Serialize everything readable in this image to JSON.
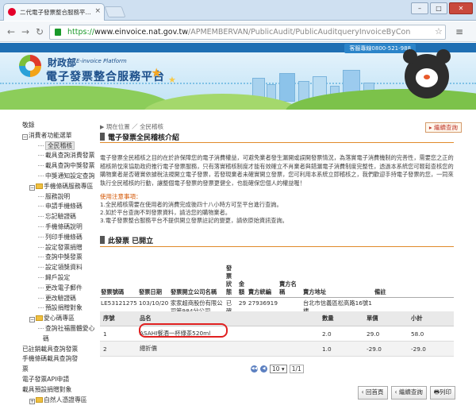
{
  "browser": {
    "tab_title": "二代電子發票整合服務平...",
    "url_scheme": "https://",
    "url_host": "www.einvoice.nat.gov.tw",
    "url_path": "/APMEMBERVAN/PublicAudit/PublicAuditqueryInvoiceByCon"
  },
  "header": {
    "hotline": "客服專線0800-521-988",
    "ministry": "財政部",
    "ministry_en": "E-invoice Platform",
    "platform": "電子發票整合服務平台"
  },
  "sidebar": {
    "items": [
      {
        "label": "敬錄",
        "level": 0
      },
      {
        "label": "消費者功能選單",
        "level": 0,
        "toggle": "-"
      },
      {
        "label": "全民稽核",
        "level": 2,
        "selected": true
      },
      {
        "label": "載具查詢消費發票",
        "level": 2
      },
      {
        "label": "載具查詢中獎發票",
        "level": 2
      },
      {
        "label": "中獎通知設定查詢",
        "level": 2
      },
      {
        "label": "手機條碼服務專區",
        "level": 1,
        "toggle": "-",
        "folder": true
      },
      {
        "label": "服務說明",
        "level": 2
      },
      {
        "label": "申請手機條碼",
        "level": 2
      },
      {
        "label": "忘記驗證碼",
        "level": 2
      },
      {
        "label": "手機條碼說明",
        "level": 2
      },
      {
        "label": "列印手機條碼",
        "level": 2
      },
      {
        "label": "設定發票捐贈",
        "level": 2
      },
      {
        "label": "查詢中獎發票",
        "level": 2
      },
      {
        "label": "設定領獎資料",
        "level": 2
      },
      {
        "label": "歸戶設定",
        "level": 2
      },
      {
        "label": "更改電子郵件",
        "level": 2
      },
      {
        "label": "更改驗證碼",
        "level": 2
      },
      {
        "label": "預設捐贈對象",
        "level": 2
      },
      {
        "label": "愛心碼專區",
        "level": 1,
        "toggle": "-",
        "folder": true
      },
      {
        "label": "查詢社福團體愛心",
        "level": 2
      },
      {
        "label": "碼",
        "level": 3
      },
      {
        "label": "已註銷載具查詢發票",
        "level": 0
      },
      {
        "label": "手機條碼載具查詢發",
        "level": 0
      },
      {
        "label": "票",
        "level": 0
      },
      {
        "label": "電子發票API申請",
        "level": 0
      },
      {
        "label": "載具預設捐贈對象",
        "level": 0
      },
      {
        "label": "自然人憑證專區",
        "level": 1,
        "toggle": "+",
        "folder": true
      }
    ]
  },
  "main": {
    "breadcrumb_prefix": "現在位置",
    "breadcrumb_page": "全民稽核",
    "go_back": "繼續查詢",
    "section_title": "電子發票全民稽核介紹",
    "intro": "電子發票全民稽核之目的在於許保障您的電子消費權益，可避免業者發生漏開或誤開發票情況，為落實電子消費機制的完善性，需要您之正的稽核熱忱來協助政府推行電子發票服務，只有落實稽核制度才能有效確立不肖業者與錯漏電子消費制度完整性，透過本系統您可輕鬆查核您的購物業者是否確實依據稅法規開立電子發票，若發現業者未確實開立發票，您可利用本系統立即稽核之，我們歡迎手持電子發票的您，一同來執行全民稽核的行動，讓整個電子發票的發票更健全，也能確保您個人的權益喔！",
    "notes_title": "使用注意事項：",
    "notes": [
      "1.全民稽核需要在使用者的消費完成後四十八小時方可至平台進行查詢。",
      "2.如於平台查詢不到發票資料，請洽您的購物業者。",
      "3.電子發票整合服務平台不提供開立發票註記的變更，請依原始資訊查詢。"
    ],
    "status_title": "此發票 已開立",
    "invoice_header": {
      "cols": [
        "發票號碼",
        "發票日期",
        "發票開立公司名稱",
        "發票狀態",
        "金額",
        "賣方統編",
        "賣方名稱",
        "賣方地址",
        "備註"
      ],
      "row": [
        "LE53121275",
        "103/10/20",
        "家家超商股份有限公司第984分公司",
        "已確認",
        "29",
        "27936919",
        "",
        "台北市信義區松高路16號1樓",
        ""
      ]
    },
    "items_table": {
      "cols": [
        "序號",
        "品名",
        "數量",
        "單價",
        "小計"
      ],
      "rows": [
        [
          "1",
          "ASAHI餐酒一杯綠茶520ml",
          "2.0",
          "29.0",
          "58.0"
        ],
        [
          "2",
          "總折價",
          "1.0",
          "-29.0",
          "-29.0"
        ]
      ]
    },
    "pager": {
      "page_size": "10",
      "page": "1/1"
    },
    "buttons": {
      "home": "回首頁",
      "continue": "繼續查詢",
      "print": "列印"
    }
  }
}
